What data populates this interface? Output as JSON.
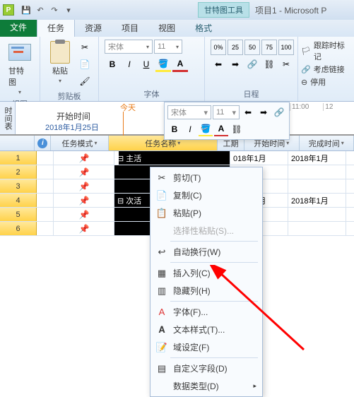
{
  "titlebar": {
    "app_letter": "P",
    "gantt_tool": "甘特图工具",
    "app_title": "项目1 - Microsoft P"
  },
  "tabs": {
    "file": "文件",
    "task": "任务",
    "resource": "资源",
    "project": "项目",
    "view": "视图",
    "format": "格式"
  },
  "ribbon": {
    "view_group": "视图",
    "gantt_btn": "甘特图",
    "clipboard_group": "剪贴板",
    "paste_btn": "粘贴",
    "font_group": "字体",
    "font_name": "宋体",
    "font_size": "11",
    "schedule_group": "日程",
    "track_markers": "跟踪时标记",
    "consider_links": "考虑链接",
    "deactivate": "停用"
  },
  "timeline": {
    "vlabel": "时间表",
    "today": "今天",
    "start_label": "开始时间",
    "start_date": "2018年1月25日",
    "mini_font": "宋体",
    "mini_size": "11",
    "mark1": "11:00",
    "mark2": "12"
  },
  "grid": {
    "headers": {
      "mode": "任务模式",
      "name": "任务名称",
      "duration": "工期",
      "start": "开始时间",
      "finish": "完成时间"
    },
    "rows": [
      {
        "num": "1",
        "name": "⊟ 主活",
        "start": "018年1月",
        "finish": "2018年1月"
      },
      {
        "num": "2",
        "name": "",
        "start": "",
        "finish": ""
      },
      {
        "num": "3",
        "name": "",
        "start": "",
        "finish": ""
      },
      {
        "num": "4",
        "name": "⊟ 次活",
        "start": "018年1月",
        "finish": "2018年1月"
      },
      {
        "num": "5",
        "name": "",
        "start": "",
        "finish": ""
      },
      {
        "num": "6",
        "name": "",
        "start": "",
        "finish": ""
      }
    ]
  },
  "context_menu": {
    "cut": "剪切(T)",
    "copy": "复制(C)",
    "paste": "粘贴(P)",
    "paste_special": "选择性粘贴(S)...",
    "wrap": "自动换行(W)",
    "insert_col": "插入列(C)",
    "hide_col": "隐藏列(H)",
    "font": "字体(F)...",
    "text_style": "文本样式(T)...",
    "field_settings": "域设定(F)",
    "custom_fields": "自定义字段(D)",
    "data_type": "数据类型(D)"
  }
}
